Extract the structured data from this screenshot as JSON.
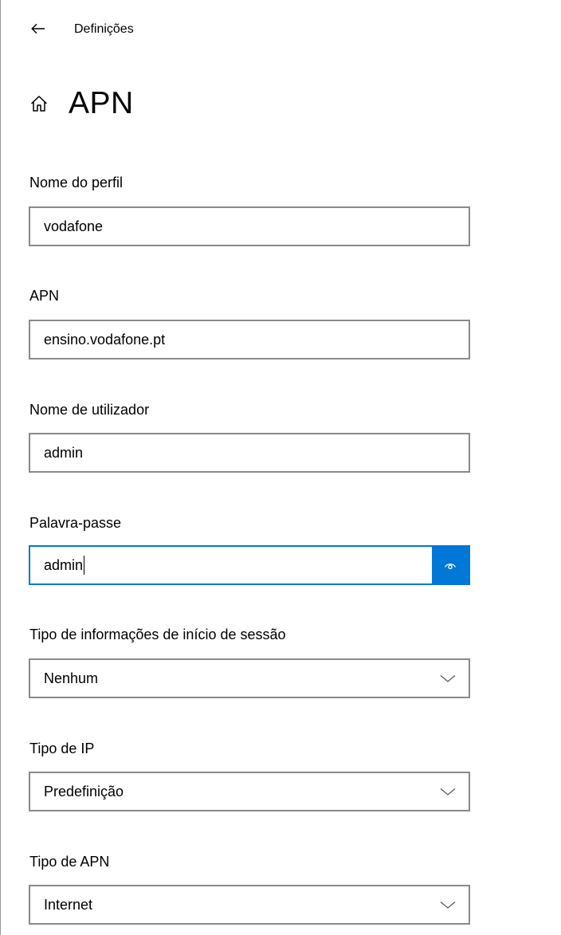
{
  "window": {
    "title": "Definições",
    "back_icon": "back-arrow-icon"
  },
  "page": {
    "title": "APN",
    "icon": "home-icon"
  },
  "fields": {
    "profile_name": {
      "label": "Nome do perfil",
      "value": "vodafone"
    },
    "apn": {
      "label": "APN",
      "value": "ensino.vodafone.pt"
    },
    "username": {
      "label": "Nome de utilizador",
      "value": "admin"
    },
    "password": {
      "label": "Palavra-passe",
      "value": "admin",
      "reveal_icon": "eye-icon"
    },
    "signin_type": {
      "label": "Tipo de informações de início de sessão",
      "selected": "Nenhum"
    },
    "ip_type": {
      "label": "Tipo de IP",
      "selected": "Predefinição"
    },
    "apn_type": {
      "label": "Tipo de APN",
      "selected": "Internet"
    }
  },
  "colors": {
    "accent": "#0078d7",
    "border": "#8a8a8a"
  }
}
